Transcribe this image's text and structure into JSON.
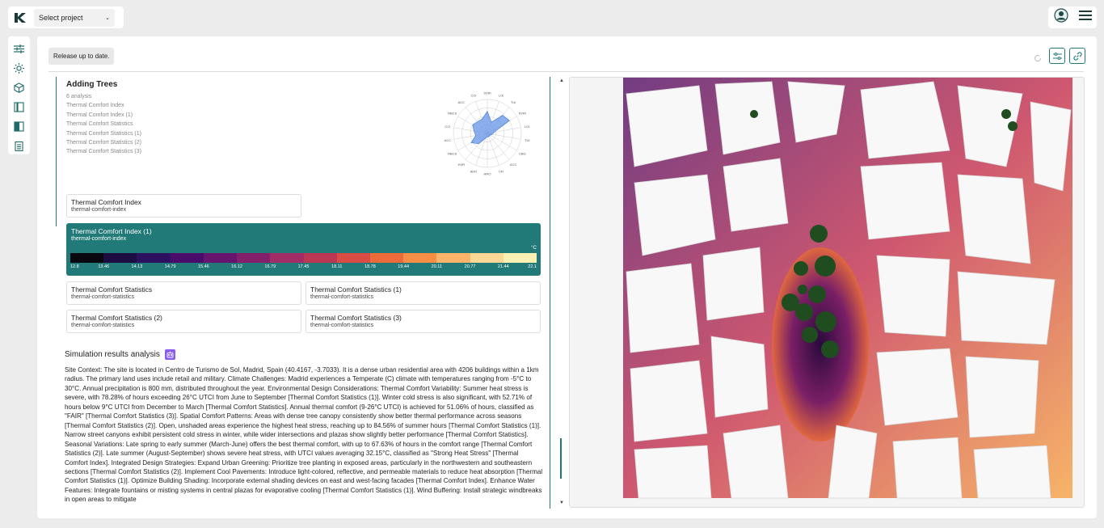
{
  "topbar": {
    "project_select_label": "Select project"
  },
  "toolbar": {
    "release_label": "Release up to date."
  },
  "panel": {
    "title": "Adding Trees",
    "analysis_count": "6 analysis",
    "analyses": [
      "Thermal Comfort Index",
      "Thermal Comfort Index (1)",
      "Thermal Comfort Statistics",
      "Thermal Comfort Statistics (1)",
      "Thermal Comfort Statistics (2)",
      "Thermal Comfort Statistics (3)"
    ]
  },
  "radar": {
    "labels": [
      "SVRI",
      "LOI",
      "TUI",
      "SVRI",
      "LOI",
      "TUI",
      "CBG",
      "ACC",
      "CFI",
      "HRO",
      "AHO",
      "HVR",
      "RBCS",
      "ACC",
      "CCI",
      "RBCS",
      "ACC",
      "CCI"
    ],
    "values": [
      0.65,
      0.35,
      0.7,
      0.75,
      0.2,
      0.15,
      0.1,
      0.1,
      0.1,
      0.1,
      0.15,
      0.4,
      0.55,
      0.35,
      0.4,
      0.5,
      0.45,
      0.45
    ]
  },
  "cards": [
    {
      "title": "Thermal Comfort Index",
      "slug": "thermal-comfort-index"
    },
    {
      "title": "Thermal Comfort Index (1)",
      "slug": "thermal-comfort-index"
    },
    {
      "title": "Thermal Comfort Statistics",
      "slug": "thermal-comfort-statistics"
    },
    {
      "title": "Thermal Comfort Statistics (1)",
      "slug": "thermal-comfort-statistics"
    },
    {
      "title": "Thermal Comfort Statistics (2)",
      "slug": "thermal-comfort-statistics"
    },
    {
      "title": "Thermal Comfort Statistics (3)",
      "slug": "thermal-comfort-statistics"
    }
  ],
  "colorbar": {
    "unit": "°C",
    "ticks": [
      "12.8",
      "13.46",
      "14.13",
      "14.79",
      "15.46",
      "16.12",
      "16.79",
      "17.45",
      "18.11",
      "18.78",
      "19.44",
      "20.11",
      "20.77",
      "21.44",
      "22.1"
    ],
    "colors": [
      "#080710",
      "#1b0c41",
      "#2c1160",
      "#4a0c6b",
      "#65156e",
      "#84206b",
      "#a22c66",
      "#bc3754",
      "#d94b45",
      "#ed6a3a",
      "#f68e46",
      "#fbb46a",
      "#fcd796",
      "#fcf0b4"
    ]
  },
  "simulation": {
    "title": "Simulation results analysis",
    "text": "Site Context: The site is located in Centro de Turismo de Sol, Madrid, Spain (40.4167, -3.7033). It is a dense urban residential area with 4206 buildings within a 1km radius. The primary land uses include retail and military. Climate Challenges: Madrid experiences a Temperate (C) climate with temperatures ranging from -5°C to 30°C. Annual precipitation is 800 mm, distributed throughout the year. Environmental Design Considerations: Thermal Comfort Variability: Summer heat stress is severe, with 78.28% of hours exceeding 26°C UTCI from June to September [Thermal Comfort Statistics (1)]. Winter cold stress is also significant, with 52.71% of hours below 9°C UTCI from December to March [Thermal Comfort Statistics]. Annual thermal comfort (9-26°C UTCI) is achieved for 51.06% of hours, classified as \"FAIR\" [Thermal Comfort Statistics (3)]. Spatial Comfort Patterns: Areas with dense tree canopy consistently show better thermal performance across seasons [Thermal Comfort Statistics (2)]. Open, unshaded areas experience the highest heat stress, reaching up to 84.56% of summer hours [Thermal Comfort Statistics (1)]. Narrow street canyons exhibit persistent cold stress in winter, while wider intersections and plazas show slightly better performance [Thermal Comfort Statistics]. Seasonal Variations: Late spring to early summer (March-June) offers the best thermal comfort, with up to 67.63% of hours in the comfort range [Thermal Comfort Statistics (2)]. Late summer (August-September) shows severe heat stress, with UTCI values averaging 32.15°C, classified as \"Strong Heat Stress\" [Thermal Comfort Index]. Integrated Design Strategies: Expand Urban Greening: Prioritize tree planting in exposed areas, particularly in the northwestern and southeastern sections [Thermal Comfort Statistics (2)]. Implement Cool Pavements: Introduce light-colored, reflective, and permeable materials to reduce heat absorption [Thermal Comfort Statistics (1)]. Optimize Building Shading: Incorporate external shading devices on east and west-facing facades [Thermal Comfort Index]. Enhance Water Features: Integrate fountains or misting systems in central plazas for evaporative cooling [Thermal Comfort Statistics (1)]. Wind Buffering: Install strategic windbreaks in open areas to mitigate"
  }
}
